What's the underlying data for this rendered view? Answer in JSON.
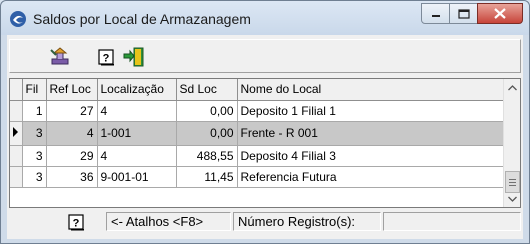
{
  "window": {
    "title": "Saldos por Local de Armazanagem",
    "controls": [
      "minimize",
      "restore",
      "close"
    ]
  },
  "toolbar": {
    "buttons": [
      {
        "icon": "stamp-icon"
      },
      {
        "icon": "help-icon"
      },
      {
        "icon": "exit-door-icon"
      }
    ]
  },
  "grid": {
    "columns": [
      "Fil",
      "Ref Loc",
      "Localização",
      "Sd Loc",
      "Nome do Local"
    ],
    "rows": [
      {
        "fil": "1",
        "ref": "27",
        "loc": "4",
        "sd": "0,00",
        "nome": "Deposito 1 Filial 1",
        "selected": false
      },
      {
        "fil": "3",
        "ref": "4",
        "loc": "1-001",
        "sd": "0,00",
        "nome": "Frente - R 001",
        "selected": true
      },
      {
        "fil": "3",
        "ref": "29",
        "loc": "4",
        "sd": "488,55",
        "nome": "Deposito 4 Filial 3",
        "selected": false
      },
      {
        "fil": "3",
        "ref": "36",
        "loc": "9-001-01",
        "sd": "11,45",
        "nome": "Referencia Futura",
        "selected": false
      }
    ],
    "selection_color": "#c8c8c8"
  },
  "statusbar": {
    "shortcuts": "<- Atalhos <F8>",
    "record_label": "Número Registro(s):",
    "record_value": ""
  }
}
